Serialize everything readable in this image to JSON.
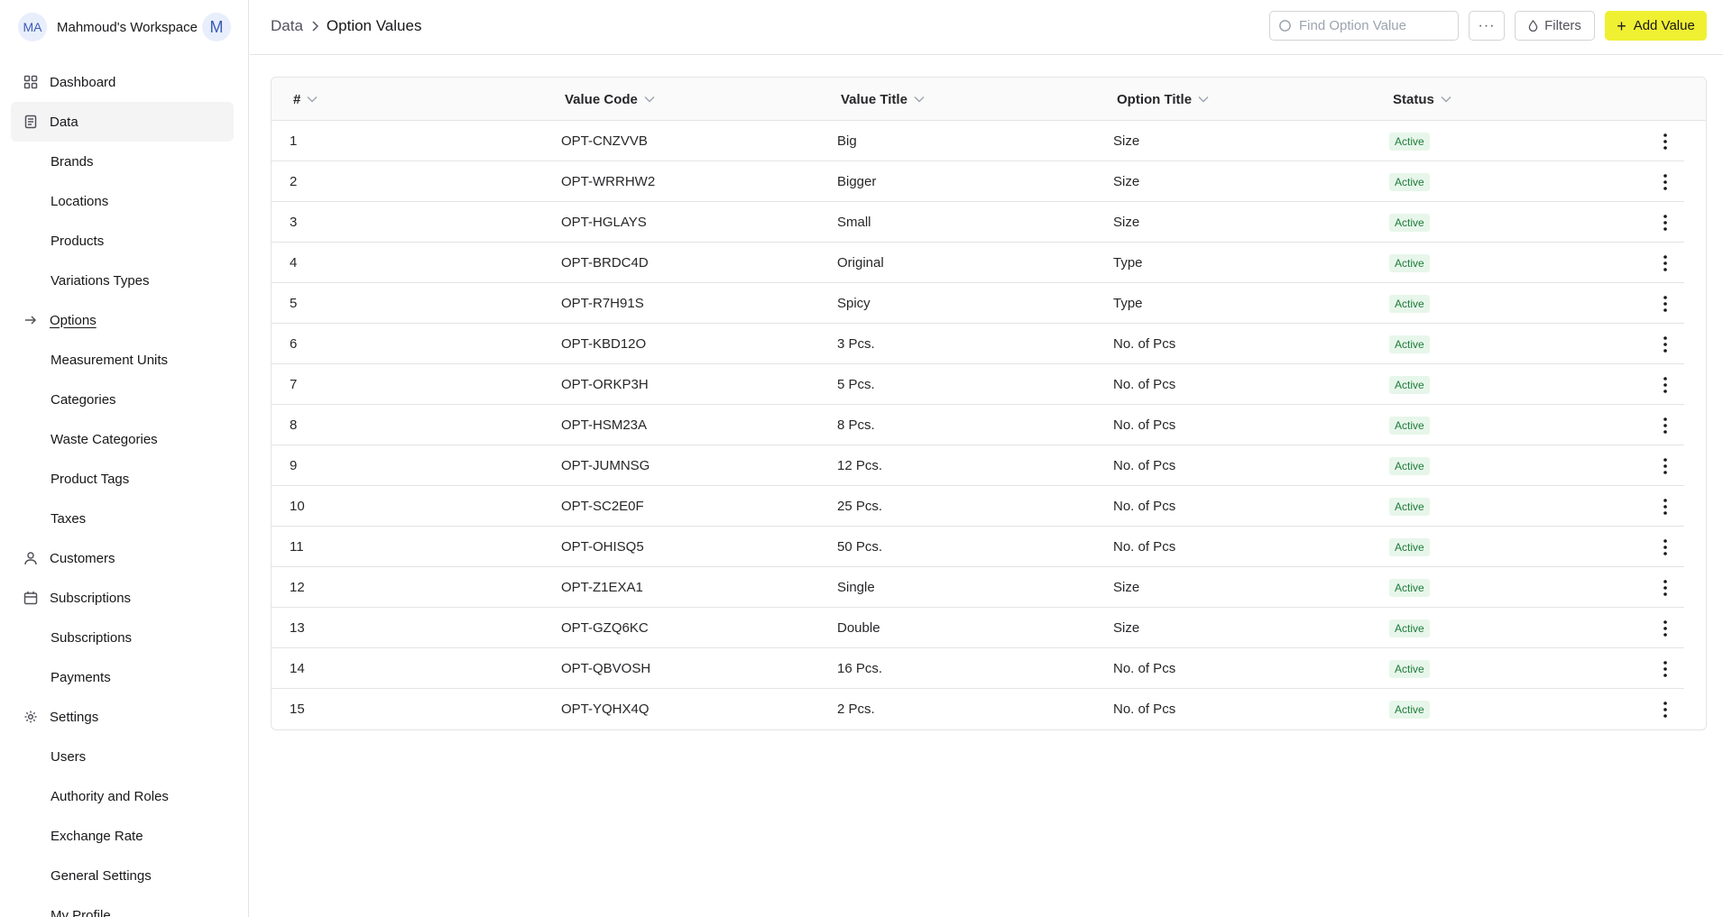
{
  "workspace": {
    "initials": "MA",
    "name": "Mahmoud's Workspace",
    "user_initial": "M"
  },
  "sidebar": {
    "items": [
      {
        "label": "Dashboard",
        "icon": "grid-icon",
        "type": "section"
      },
      {
        "label": "Data",
        "icon": "document-icon",
        "type": "section",
        "active": true
      },
      {
        "label": "Brands",
        "type": "sub"
      },
      {
        "label": "Locations",
        "type": "sub"
      },
      {
        "label": "Products",
        "type": "sub"
      },
      {
        "label": "Variations Types",
        "type": "sub"
      },
      {
        "label": "Options",
        "icon": "arrow-right-icon",
        "type": "sub",
        "current": true
      },
      {
        "label": "Measurement Units",
        "type": "sub"
      },
      {
        "label": "Categories",
        "type": "sub"
      },
      {
        "label": "Waste Categories",
        "type": "sub"
      },
      {
        "label": "Product Tags",
        "type": "sub"
      },
      {
        "label": "Taxes",
        "type": "sub"
      },
      {
        "label": "Customers",
        "icon": "user-icon",
        "type": "section"
      },
      {
        "label": "Subscriptions",
        "icon": "calendar-icon",
        "type": "section"
      },
      {
        "label": "Subscriptions",
        "type": "sub"
      },
      {
        "label": "Payments",
        "type": "sub"
      },
      {
        "label": "Settings",
        "icon": "gear-icon",
        "type": "section"
      },
      {
        "label": "Users",
        "type": "sub"
      },
      {
        "label": "Authority and Roles",
        "type": "sub"
      },
      {
        "label": "Exchange Rate",
        "type": "sub"
      },
      {
        "label": "General Settings",
        "type": "sub"
      },
      {
        "label": "My Profile",
        "type": "sub"
      }
    ]
  },
  "breadcrumb": {
    "parent": "Data",
    "current": "Option Values"
  },
  "toolbar": {
    "search_placeholder": "Find Option Value",
    "more_label": "···",
    "filters_label": "Filters",
    "add_label": "Add Value"
  },
  "table": {
    "columns": [
      "#",
      "Value Code",
      "Value Title",
      "Option Title",
      "Status"
    ],
    "rows": [
      [
        "1",
        "OPT-CNZVVB",
        "Big",
        "Size",
        "Active"
      ],
      [
        "2",
        "OPT-WRRHW2",
        "Bigger",
        "Size",
        "Active"
      ],
      [
        "3",
        "OPT-HGLAYS",
        "Small",
        "Size",
        "Active"
      ],
      [
        "4",
        "OPT-BRDC4D",
        "Original",
        "Type",
        "Active"
      ],
      [
        "5",
        "OPT-R7H91S",
        "Spicy",
        "Type",
        "Active"
      ],
      [
        "6",
        "OPT-KBD12O",
        "3 Pcs.",
        "No. of Pcs",
        "Active"
      ],
      [
        "7",
        "OPT-ORKP3H",
        "5 Pcs.",
        "No. of Pcs",
        "Active"
      ],
      [
        "8",
        "OPT-HSM23A",
        "8 Pcs.",
        "No. of Pcs",
        "Active"
      ],
      [
        "9",
        "OPT-JUMNSG",
        "12 Pcs.",
        "No. of Pcs",
        "Active"
      ],
      [
        "10",
        "OPT-SC2E0F",
        "25 Pcs.",
        "No. of Pcs",
        "Active"
      ],
      [
        "11",
        "OPT-OHISQ5",
        "50 Pcs.",
        "No. of Pcs",
        "Active"
      ],
      [
        "12",
        "OPT-Z1EXA1",
        "Single",
        "Size",
        "Active"
      ],
      [
        "13",
        "OPT-GZQ6KC",
        "Double",
        "Size",
        "Active"
      ],
      [
        "14",
        "OPT-QBVOSH",
        "16 Pcs.",
        "No. of Pcs",
        "Active"
      ],
      [
        "15",
        "OPT-YQHX4Q",
        "2 Pcs.",
        "No. of Pcs",
        "Active"
      ]
    ]
  },
  "colors": {
    "accent_button": "#f0f032",
    "status_active_bg": "#e7f6ea",
    "status_active_text": "#1e7a3a"
  }
}
